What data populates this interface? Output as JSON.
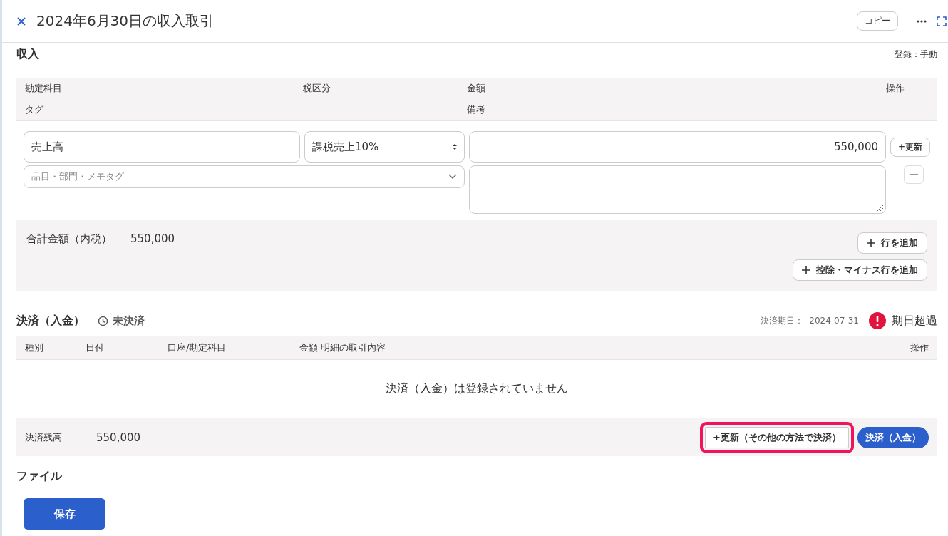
{
  "header": {
    "title": "2024年6月30日の収入取引",
    "copy_button": "コピー"
  },
  "income": {
    "title": "収入",
    "registration": "登録：手動",
    "columns_row1": [
      "勘定科目",
      "税区分",
      "金額",
      "操作"
    ],
    "columns_row2": [
      "タグ",
      "備考"
    ],
    "line": {
      "account": "売上高",
      "tax": "課税売上10%",
      "amount": "550,000",
      "tag_placeholder": "品目・部門・メモタグ",
      "update_button": "+更新"
    },
    "total_label": "合計金額（内税）",
    "total_value": "550,000",
    "add_buttons": [
      "行を追加",
      "控除・マイナス行を追加"
    ]
  },
  "settlement": {
    "title": "決済（入金）",
    "status": "未決済",
    "due_label": "決済期日：",
    "due_date": "2024-07-31",
    "overdue": true,
    "overdue_label": "期日超過",
    "columns": [
      "種別",
      "日付",
      "口座/勘定科目",
      "金額",
      "明細の取引内容",
      "操作"
    ],
    "empty_message": "決済（入金）は登録されていません",
    "balance_label": "決済残高",
    "balance_value": "550,000",
    "buttons": [
      {
        "kind": "secondary",
        "label": "+更新（その他の方法で決済）",
        "highlighted": true
      },
      {
        "kind": "primary",
        "label": "決済（入金）",
        "highlighted": false
      }
    ]
  },
  "files": {
    "title": "ファイル"
  },
  "footer": {
    "save_button": "保存"
  }
}
